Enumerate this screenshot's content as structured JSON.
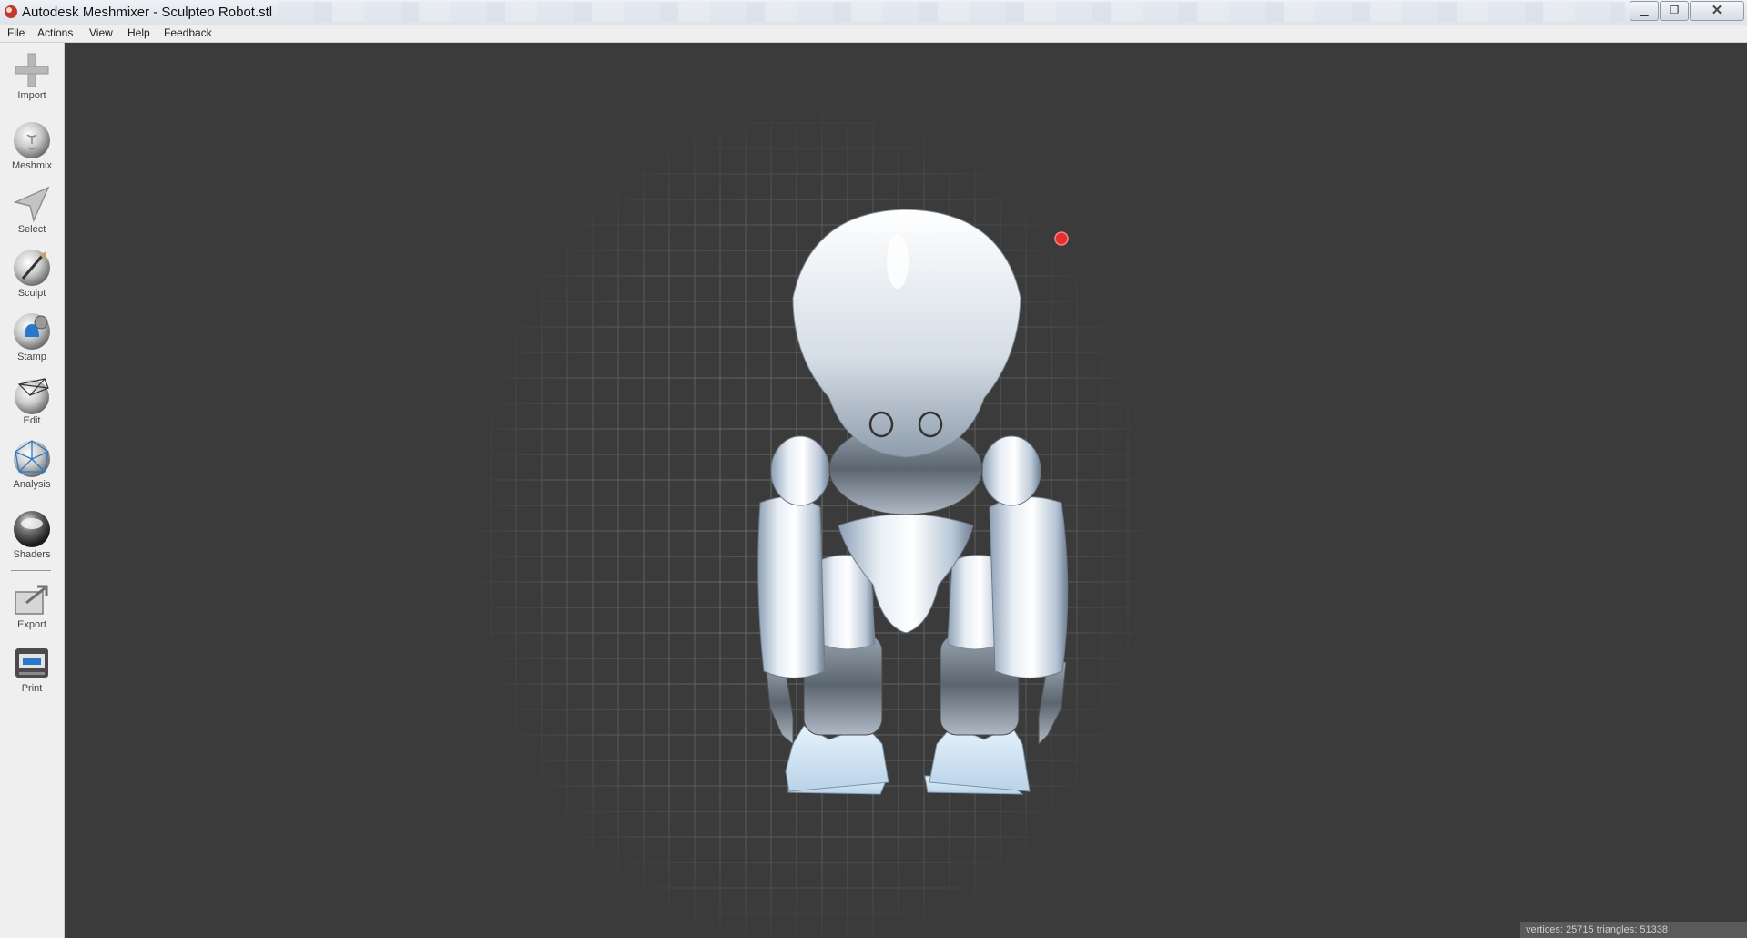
{
  "window": {
    "title": "Autodesk Meshmixer - Sculpteo Robot.stl",
    "minimize_symbol": "▁",
    "maximize_symbol": "❐",
    "close_symbol": "✕"
  },
  "menu": {
    "items": [
      "File",
      "Actions",
      "View",
      "Help",
      "Feedback"
    ]
  },
  "toolbar": {
    "items": [
      {
        "label": "Import",
        "icon": "plus-icon"
      },
      {
        "label": "Meshmix",
        "icon": "meshmix-sphere-icon"
      },
      {
        "label": "Select",
        "icon": "arrow-icon"
      },
      {
        "label": "Sculpt",
        "icon": "brush-sphere-icon"
      },
      {
        "label": "Stamp",
        "icon": "stamp-sphere-icon"
      },
      {
        "label": "Edit",
        "icon": "edit-sphere-icon"
      },
      {
        "label": "Analysis",
        "icon": "analysis-sphere-icon"
      },
      {
        "label": "Shaders",
        "icon": "shader-sphere-icon"
      },
      {
        "label": "Export",
        "icon": "export-icon"
      },
      {
        "label": "Print",
        "icon": "printer-icon"
      }
    ]
  },
  "status": {
    "text": "vertices: 25715  triangles: 51338"
  },
  "colors": {
    "viewport_bg": "#3b3b3b",
    "grid": "#6a6a6a",
    "model": "#cfd8e2",
    "pivot_marker": "#e03030"
  }
}
